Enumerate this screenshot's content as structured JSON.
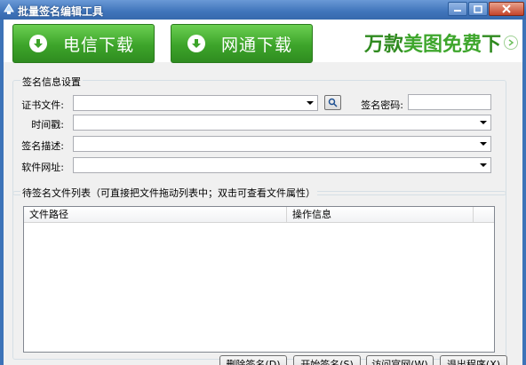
{
  "window": {
    "title": "批量签名编辑工具"
  },
  "banner": {
    "telecom_label": "电信下载",
    "netcom_label": "网通下载",
    "promo_part1": "万款",
    "promo_part2": "美图免费",
    "promo_part3": "下"
  },
  "sign_info": {
    "group_title": "签名信息设置",
    "cert_label": "证书文件:",
    "cert_value": "",
    "password_label": "签名密码:",
    "password_value": "",
    "timestamp_label": "时间戳:",
    "timestamp_value": "",
    "description_label": "签名描述:",
    "description_value": "",
    "url_label": "软件网址:",
    "url_value": ""
  },
  "file_list": {
    "group_title": "待签名文件列表（可直接把文件拖动列表中；双击可查看文件属性）",
    "columns": [
      "文件路径",
      "操作信息"
    ],
    "rows": []
  },
  "buttons": {
    "delete": "删除签名(D)",
    "start": "开始签名(S)",
    "visit": "访问官网(W)",
    "exit": "退出程序(X)"
  },
  "colors": {
    "title_bar": "#3f74ba",
    "download_green": "#3da42a",
    "promo_green": "#2f8a1f"
  }
}
